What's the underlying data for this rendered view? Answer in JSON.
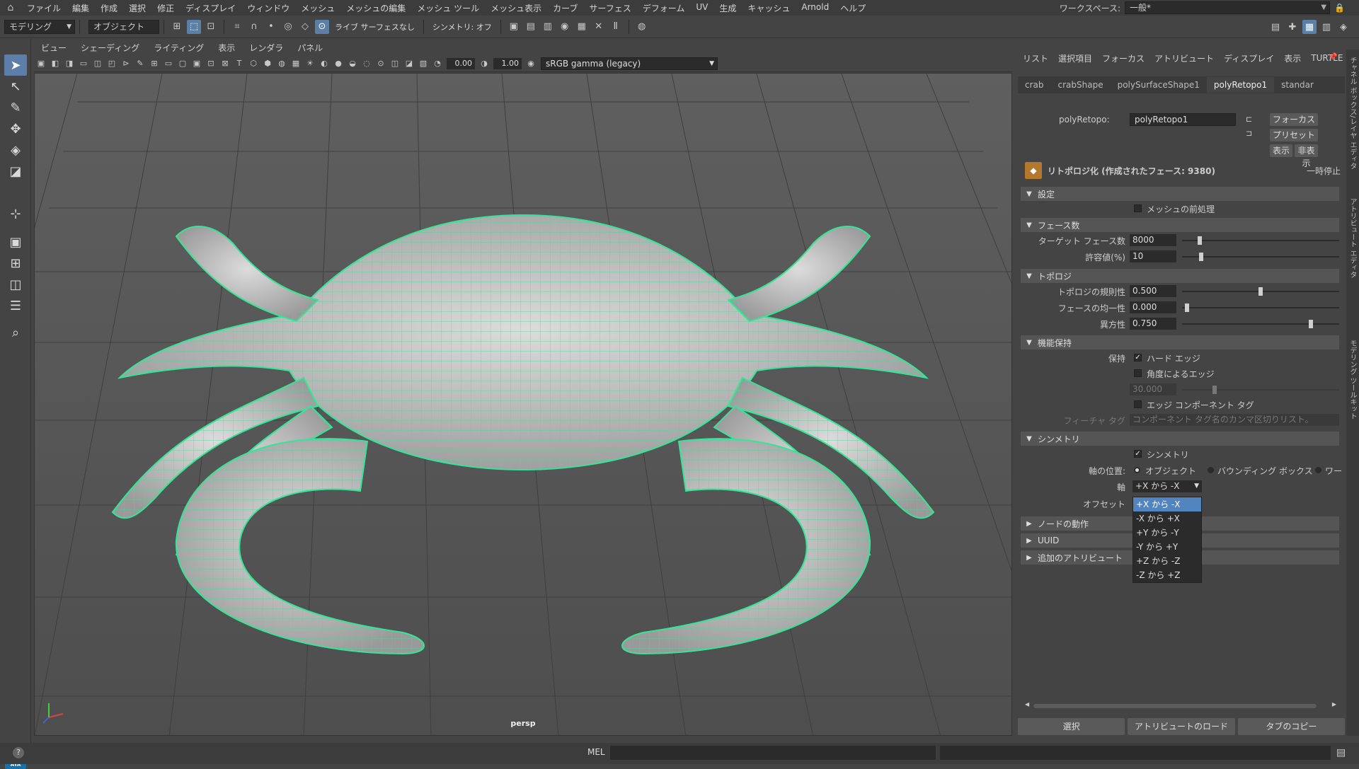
{
  "menubar": {
    "items": [
      "ファイル",
      "編集",
      "作成",
      "選択",
      "修正",
      "ディスプレイ",
      "ウィンドウ",
      "メッシュ",
      "メッシュの編集",
      "メッシュ ツール",
      "メッシュ表示",
      "カーブ",
      "サーフェス",
      "デフォーム",
      "UV",
      "生成",
      "キャッシュ",
      "Arnold",
      "ヘルプ"
    ],
    "workspace_label": "ワークスペース:",
    "workspace_value": "一般*"
  },
  "statusline": {
    "mode": "モデリング",
    "object_mode": "オブジェクト",
    "live_surface": "ライブ サーフェスなし",
    "symmetry": "シンメトリ: オフ"
  },
  "panel": {
    "menu": [
      "ビュー",
      "シェーディング",
      "ライティング",
      "表示",
      "レンダラ",
      "パネル"
    ],
    "exposure": "0.00",
    "gamma": "1.00",
    "colorspace": "sRGB gamma (legacy)",
    "camera_label": "persp"
  },
  "attribute_editor": {
    "menu": [
      "リスト",
      "選択項目",
      "フォーカス",
      "アトリビュート",
      "ディスプレイ",
      "表示",
      "TURTLE"
    ],
    "tabs": [
      "crab",
      "crabShape",
      "polySurfaceShape1",
      "polyRetopo1",
      "standar"
    ],
    "node_label": "polyRetopo:",
    "node_name": "polyRetopo1",
    "focus_btn": "フォーカス",
    "preset_btn": "プリセット",
    "show_btn": "表示",
    "hide_btn": "非表示",
    "title": "リトポロジ化 (作成されたフェース: 9380)",
    "pause": "一時停止",
    "sections": {
      "settings": "設定",
      "face_count": "フェース数",
      "topology": "トポロジ",
      "feature": "機能保持",
      "symmetry": "シンメトリ",
      "node_behavior": "ノードの動作",
      "uuid": "UUID",
      "extra": "追加のアトリビュート"
    },
    "preprocess": "メッシュの前処理",
    "target_faces_label": "ターゲット フェース数",
    "target_faces": "8000",
    "tolerance_label": "許容値(%)",
    "tolerance": "10",
    "regularity_label": "トポロジの規則性",
    "regularity": "0.500",
    "uniformity_label": "フェースの均一性",
    "uniformity": "0.000",
    "anisotropy_label": "異方性",
    "anisotropy": "0.750",
    "preserve_label": "保持",
    "hard_edges": "ハード エッジ",
    "angle_edges": "角度によるエッジ",
    "angle_value": "30.000",
    "edge_tag": "エッジ コンポーネント タグ",
    "feature_tag_label": "フィーチャ タグ",
    "feature_tag_placeholder": "コンポーネント タグ名のカンマ区切りリスト。",
    "symmetry_cb": "シンメトリ",
    "axis_pos_label": "軸の位置:",
    "axis_pos_object": "オブジェクト",
    "axis_pos_bbox": "バウンディング ボックス",
    "axis_pos_world": "ワー",
    "axis_label": "軸",
    "axis_value": "+X から -X",
    "offset_label": "オフセット",
    "axis_options": [
      "+X から -X",
      "-X から +X",
      "+Y から -Y",
      "-Y から +Y",
      "+Z から -Z",
      "-Z から +Z"
    ],
    "bottom": [
      "選択",
      "アトリビュートのロード",
      "タブのコピー"
    ]
  },
  "sliders": {
    "target_faces": 0.1,
    "tolerance": 0.11,
    "regularity": 0.5,
    "uniformity": 0.02,
    "anisotropy": 0.83,
    "angle": 0.2
  },
  "cmdline": {
    "mel": "MEL"
  },
  "vtabs": [
    "チャネル ボックス/レイヤ エディタ",
    "アトリビュート エディタ",
    "モデリング ツールキット"
  ],
  "colors": {
    "wire": "#33e59a",
    "selection": "#5285c0",
    "node_icon": "#b4772e"
  }
}
